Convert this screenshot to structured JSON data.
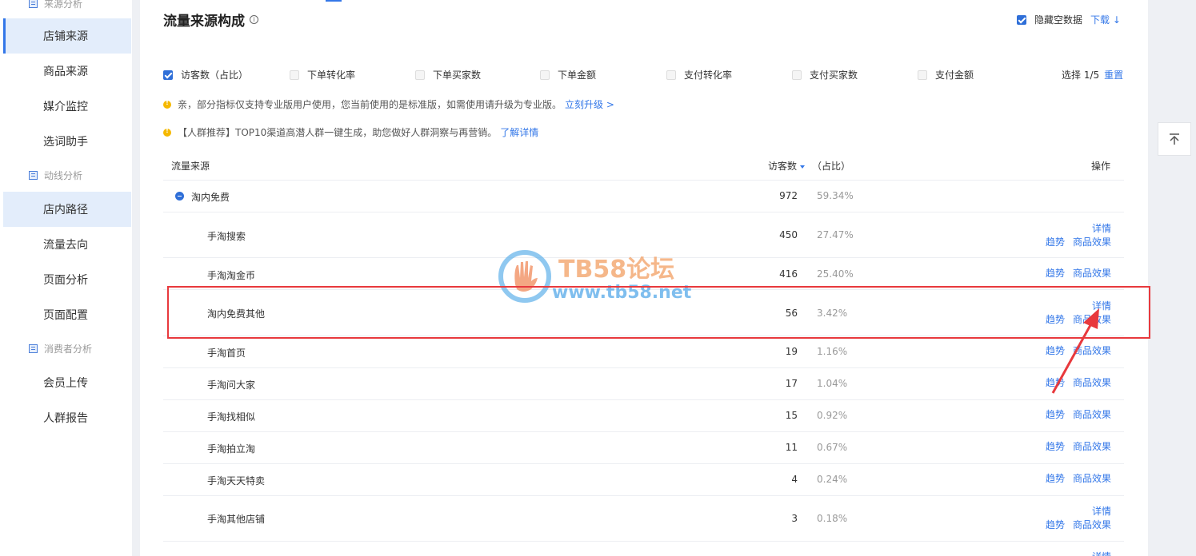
{
  "sidebar": {
    "sections": [
      {
        "title": "来源分析",
        "icon": "chart-icon"
      },
      {
        "title": "动线分析",
        "icon": "chart-icon"
      },
      {
        "title": "消费者分析",
        "icon": "chart-icon"
      }
    ],
    "items": [
      {
        "label": "店铺来源"
      },
      {
        "label": "商品来源"
      },
      {
        "label": "媒介监控"
      },
      {
        "label": "选词助手"
      },
      {
        "label": "店内路径"
      },
      {
        "label": "流量去向"
      },
      {
        "label": "页面分析"
      },
      {
        "label": "页面配置"
      },
      {
        "label": "会员上传"
      },
      {
        "label": "人群报告"
      }
    ]
  },
  "card": {
    "title": "流量来源构成",
    "info_icon": "i",
    "hide_empty_label": "隐藏空数据",
    "download_label": "下载",
    "download_icon": "↓"
  },
  "metrics": {
    "options": [
      {
        "label": "访客数（占比）",
        "checked": true
      },
      {
        "label": "下单转化率",
        "checked": false
      },
      {
        "label": "下单买家数",
        "checked": false
      },
      {
        "label": "下单金额",
        "checked": false
      },
      {
        "label": "支付转化率",
        "checked": false
      },
      {
        "label": "支付买家数",
        "checked": false
      },
      {
        "label": "支付金额",
        "checked": false
      }
    ],
    "count_label": "选择 1/5",
    "reset_label": "重置"
  },
  "notices": [
    {
      "text": "亲，部分指标仅支持专业版用户使用，您当前使用的是标准版，如需使用请升级为专业版。",
      "link": "立刻升级 >"
    },
    {
      "text": "【人群推荐】TOP10渠道高潜人群一键生成，助您做好人群洞察与再营销。",
      "link": "了解详情"
    }
  ],
  "table": {
    "headers": {
      "source": "流量来源",
      "visitors": "访客数",
      "ratio": "（占比）",
      "ops": "操作"
    },
    "parent": {
      "name": "淘内免费",
      "value": "972",
      "pct": "59.34%"
    },
    "rows": [
      {
        "name": "手淘搜索",
        "value": "450",
        "pct": "27.47%",
        "detail": "详情",
        "trend": "趋势",
        "effect": "商品效果"
      },
      {
        "name": "手淘淘金币",
        "value": "416",
        "pct": "25.40%",
        "detail": "",
        "trend": "趋势",
        "effect": "商品效果"
      },
      {
        "name": "淘内免费其他",
        "value": "56",
        "pct": "3.42%",
        "detail": "详情",
        "trend": "趋势",
        "effect": "商品效果"
      },
      {
        "name": "手淘首页",
        "value": "19",
        "pct": "1.16%",
        "detail": "",
        "trend": "趋势",
        "effect": "商品效果"
      },
      {
        "name": "手淘问大家",
        "value": "17",
        "pct": "1.04%",
        "detail": "",
        "trend": "趋势",
        "effect": "商品效果"
      },
      {
        "name": "手淘找相似",
        "value": "15",
        "pct": "0.92%",
        "detail": "",
        "trend": "趋势",
        "effect": "商品效果"
      },
      {
        "name": "手淘拍立淘",
        "value": "11",
        "pct": "0.67%",
        "detail": "",
        "trend": "趋势",
        "effect": "商品效果"
      },
      {
        "name": "手淘天天特卖",
        "value": "4",
        "pct": "0.24%",
        "detail": "",
        "trend": "趋势",
        "effect": "商品效果"
      },
      {
        "name": "手淘其他店铺",
        "value": "3",
        "pct": "0.18%",
        "detail": "详情",
        "trend": "趋势",
        "effect": "商品效果"
      }
    ],
    "partial_next_detail": "详情"
  },
  "watermark": {
    "title": "TB58论坛",
    "url": "www.tb58.net"
  },
  "colors": {
    "accent": "#3377e8",
    "highlight": "#e8393d",
    "notice": "#f5b800"
  }
}
